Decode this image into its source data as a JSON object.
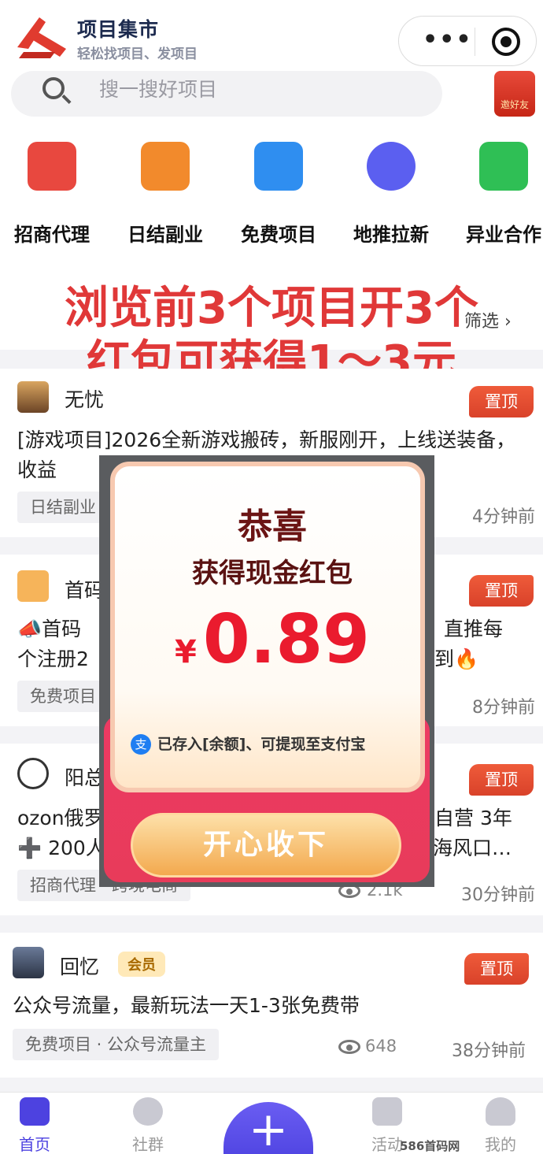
{
  "header": {
    "title": "项目集市",
    "subtitle": "轻松找项目、发项目"
  },
  "search": {
    "placeholder": "搜一搜好项目",
    "invite_label": "邀好友"
  },
  "categories": [
    {
      "label": "招商代理",
      "color": "#e8483f"
    },
    {
      "label": "日结副业",
      "color": "#f28a2c"
    },
    {
      "label": "免费项目",
      "color": "#2f8ef0"
    },
    {
      "label": "地推拉新",
      "color": "#5b5ff0"
    },
    {
      "label": "异业合作",
      "color": "#2fbf55"
    }
  ],
  "overlay_text": {
    "line1": "浏览前3个项目开3个",
    "line2": "红包可获得1～3元"
  },
  "filter_stub": "筛选 ›",
  "posts": [
    {
      "author": "无忧",
      "pin": "置顶",
      "title": "[游戏项目]2026全新游戏搬砖，新服刚开，上线送装备，收益",
      "tag": "日结副业",
      "time": "4分钟前"
    },
    {
      "author": "首码",
      "pin": "置顶",
      "title": "📣首码",
      "title_right": "直推每",
      "title2": "个注册2",
      "title2_right": "到🔥",
      "tag": "免费项目",
      "time": "8分钟前"
    },
    {
      "author": "阳总",
      "pin": "置顶",
      "title": "ozon俄罗",
      "title_right": "自营 3年",
      "title2": "➕ 200人",
      "title2_right": "海风口…",
      "tag": "招商代理 · 跨境电商",
      "views": "2.1k",
      "time": "30分钟前"
    },
    {
      "author": "回忆",
      "vip": "会员",
      "pin": "置顶",
      "title": "公众号流量，最新玩法一天1-3张免费带",
      "tag": "免费项目 · 公众号流量主",
      "views": "648",
      "time": "38分钟前"
    }
  ],
  "popup": {
    "title": "恭喜",
    "subtitle": "获得现金红包",
    "currency": "¥",
    "amount": "0.89",
    "note": "已存入[余额]、可提现至支付宝",
    "button": "开心收下"
  },
  "tabbar": {
    "home": "首页",
    "community": "社群",
    "activity": "活动",
    "mine": "我的",
    "accent": "#4d42e0"
  },
  "watermark": "586首码网 www.h586.com"
}
